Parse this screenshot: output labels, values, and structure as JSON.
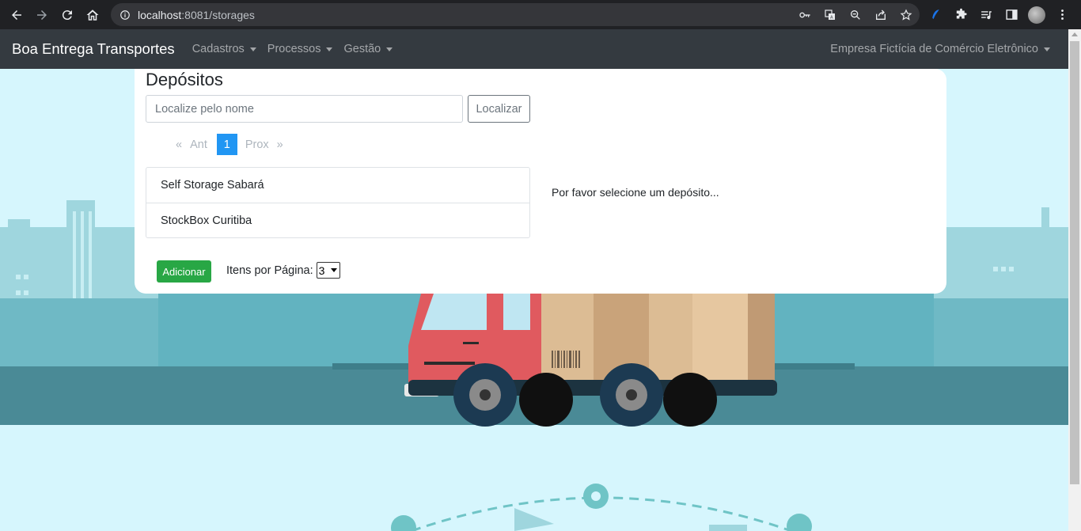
{
  "browser": {
    "url_host": "localhost",
    "url_path": ":8081/storages"
  },
  "navbar": {
    "brand": "Boa Entrega Transportes",
    "menus": [
      {
        "label": "Cadastros"
      },
      {
        "label": "Processos"
      },
      {
        "label": "Gestão"
      }
    ],
    "company": "Empresa Fictícia de Comércio Eletrônico"
  },
  "page": {
    "title": "Depósitos",
    "search": {
      "placeholder": "Localize pelo nome",
      "button_label": "Localizar"
    },
    "pagination": {
      "first": "«",
      "prev": "Ant",
      "current": "1",
      "next": "Prox",
      "last": "»"
    },
    "storages": [
      {
        "name": "Self Storage Sabará"
      },
      {
        "name": "StockBox Curitiba"
      }
    ],
    "select_hint": "Por favor selecione um depósito...",
    "add_button": "Adicionar",
    "per_page_label": "Itens por Página:",
    "per_page_value": "3"
  },
  "colors": {
    "navbar_bg": "#343a40",
    "accent": "#2196f3",
    "add_button": "#28a745",
    "background": "#d6f6fd"
  }
}
